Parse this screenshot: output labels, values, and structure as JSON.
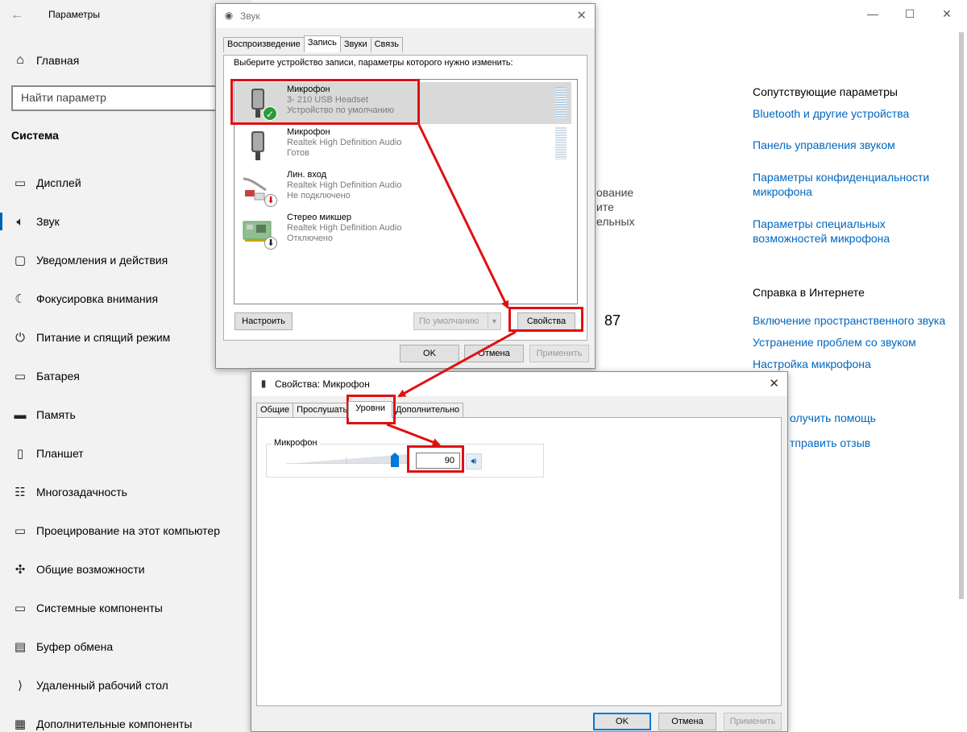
{
  "settings": {
    "title": "Параметры",
    "back_icon": "back-arrow-icon",
    "home": {
      "icon": "home-icon",
      "label": "Главная"
    },
    "search_placeholder": "Найти параметр",
    "section": "Система",
    "nav_items": [
      {
        "icon": "display-icon",
        "label": "Дисплей"
      },
      {
        "icon": "speaker-icon",
        "label": "Звук"
      },
      {
        "icon": "notifications-icon",
        "label": "Уведомления и действия"
      },
      {
        "icon": "moon-icon",
        "label": "Фокусировка внимания"
      },
      {
        "icon": "power-icon",
        "label": "Питание и спящий режим"
      },
      {
        "icon": "battery-icon",
        "label": "Батарея"
      },
      {
        "icon": "storage-icon",
        "label": "Память"
      },
      {
        "icon": "tablet-icon",
        "label": "Планшет"
      },
      {
        "icon": "multitasking-icon",
        "label": "Многозадачность"
      },
      {
        "icon": "projecting-icon",
        "label": "Проецирование на этот компьютер"
      },
      {
        "icon": "shared-experiences-icon",
        "label": "Общие возможности"
      },
      {
        "icon": "system-components-icon",
        "label": "Системные компоненты"
      },
      {
        "icon": "clipboard-icon",
        "label": "Буфер обмена"
      },
      {
        "icon": "remote-desktop-icon",
        "label": "Удаленный рабочий стол"
      },
      {
        "icon": "optional-features-icon",
        "label": "Дополнительные компоненты"
      }
    ],
    "window_controls": {
      "minimize": "—",
      "maximize": "☐",
      "close": "✕"
    },
    "related_heading": "Сопутствующие параметры",
    "related_links": [
      "Bluetooth и другие устройства",
      "Панель управления звуком",
      "Параметры конфиденциальности микрофона",
      "Параметры специальных возможностей микрофона"
    ],
    "help_heading": "Справка в Интернете",
    "help_links": [
      "Включение пространственного звука",
      "Устранение проблем со звуком",
      "Настройка микрофона"
    ],
    "bottom_links": [
      "олучить помощь",
      "тправить отзыв"
    ],
    "background_fragments": [
      "ование",
      "ите",
      "ельных"
    ],
    "number_87": "87"
  },
  "sound_dialog": {
    "title": "Звук",
    "tabs": [
      "Воспроизведение",
      "Запись",
      "Звуки",
      "Связь"
    ],
    "active_tab": "Запись",
    "instruction": "Выберите устройство записи, параметры которого нужно изменить:",
    "devices": [
      {
        "name": "Микрофон",
        "driver": "3- 210 USB Headset",
        "status": "Устройство по умолчанию",
        "icon": "microphone-icon",
        "badge": "default-check-icon",
        "selected": true
      },
      {
        "name": "Микрофон",
        "driver": "Realtek High Definition Audio",
        "status": "Готов",
        "icon": "microphone-icon",
        "badge": "",
        "selected": false
      },
      {
        "name": "Лин. вход",
        "driver": "Realtek High Definition Audio",
        "status": "Не подключено",
        "icon": "line-in-icon",
        "badge": "unplugged-icon",
        "selected": false
      },
      {
        "name": "Стерео микшер",
        "driver": "Realtek High Definition Audio",
        "status": "Отключено",
        "icon": "stereo-mix-icon",
        "badge": "disabled-icon",
        "selected": false
      }
    ],
    "configure_button": "Настроить",
    "default_button": "По умолчанию",
    "properties_button": "Свойства",
    "ok_button": "OK",
    "cancel_button": "Отмена",
    "apply_button": "Применить"
  },
  "props_dialog": {
    "title": "Свойства: Микрофон",
    "tabs": [
      "Общие",
      "Прослушать",
      "Уровни",
      "Дополнительно"
    ],
    "active_tab": "Уровни",
    "group_label": "Микрофон",
    "level_value": "90",
    "level_fraction": 0.9,
    "ok_button": "OK",
    "cancel_button": "Отмена",
    "apply_button": "Применить"
  },
  "colors": {
    "accent": "#0078d7",
    "link": "#0067c0",
    "annotation_red": "#e01010",
    "default_badge_green": "#2a9d3a"
  }
}
